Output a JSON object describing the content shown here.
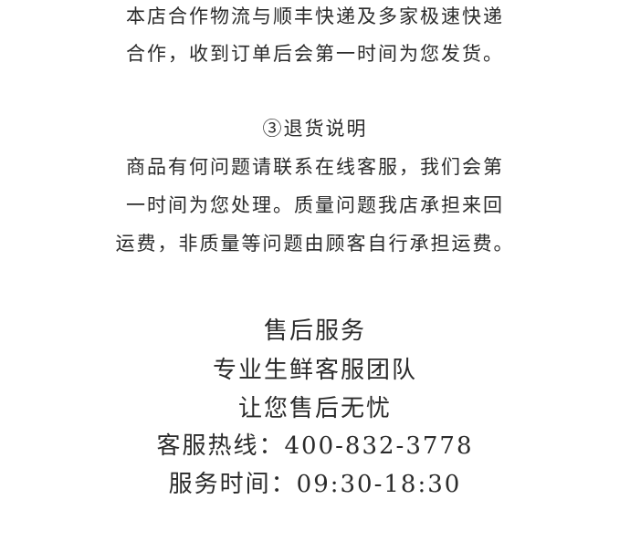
{
  "shipping": {
    "line1": "本店合作物流与顺丰快递及多家极速快递",
    "line2": "合作，收到订单后会第一时间为您发货。"
  },
  "returns": {
    "heading": "③退货说明",
    "line1": "商品有何问题请联系在线客服，我们会第",
    "line2": "一时间为您处理。质量问题我店承担来回",
    "line3": "运费，非质量等问题由顾客自行承担运费。"
  },
  "after_sales": {
    "title": "售后服务",
    "line1": "专业生鲜客服团队",
    "line2": "让您售后无忧",
    "hotline": "客服热线：400-832-3778",
    "hours": "服务时间：09:30-18:30"
  }
}
